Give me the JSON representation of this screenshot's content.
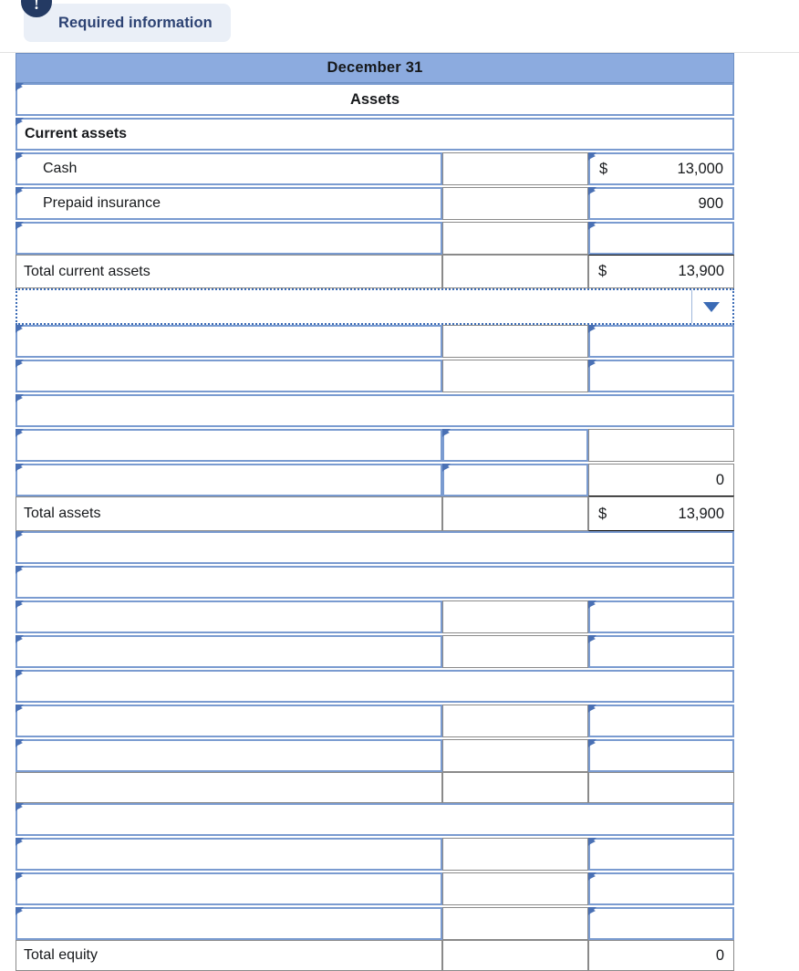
{
  "banner": {
    "icon": "exclamation-badge-icon",
    "label": "Required information"
  },
  "sheet": {
    "header": {
      "date": "December 31"
    },
    "section_title": "Assets",
    "dropdown": {
      "value": "",
      "caret": "chevron-down-icon"
    },
    "colors": {
      "header_bg": "#8cabdf",
      "input_border": "#7a9bd0",
      "marker": "#4a71b5",
      "banner_bg": "#eaeff7",
      "banner_text": "#2c4273",
      "badge_bg": "#243a63"
    },
    "rows": [
      {
        "kind": "header",
        "label": "December 31"
      },
      {
        "kind": "title",
        "label": "Assets"
      },
      {
        "kind": "subhead",
        "label": "Current assets"
      },
      {
        "kind": "line",
        "label": "Cash",
        "col2": "",
        "currency": "$",
        "amount": "13,000"
      },
      {
        "kind": "line",
        "label": "Prepaid insurance",
        "col2": "",
        "currency": "",
        "amount": "900"
      },
      {
        "kind": "line",
        "label": "",
        "col2": "",
        "currency": "",
        "amount": ""
      },
      {
        "kind": "total",
        "label": "Total current assets",
        "col2": "",
        "currency": "$",
        "amount": "13,900"
      },
      {
        "kind": "select",
        "label": ""
      },
      {
        "kind": "line",
        "label": "",
        "col2": "",
        "currency": "",
        "amount": ""
      },
      {
        "kind": "line",
        "label": "",
        "col2": "",
        "currency": "",
        "amount": ""
      },
      {
        "kind": "wide",
        "label": ""
      },
      {
        "kind": "line2",
        "label": "",
        "col2": "",
        "currency": "",
        "amount": ""
      },
      {
        "kind": "line2",
        "label": "",
        "col2": "",
        "currency": "",
        "amount": "0"
      },
      {
        "kind": "total",
        "label": "Total assets",
        "col2": "",
        "currency": "$",
        "amount": "13,900"
      },
      {
        "kind": "wide",
        "label": ""
      },
      {
        "kind": "wide",
        "label": ""
      },
      {
        "kind": "line",
        "label": "",
        "col2": "",
        "currency": "",
        "amount": ""
      },
      {
        "kind": "line",
        "label": "",
        "col2": "",
        "currency": "",
        "amount": ""
      },
      {
        "kind": "wide",
        "label": ""
      },
      {
        "kind": "line",
        "label": "",
        "col2": "",
        "currency": "",
        "amount": ""
      },
      {
        "kind": "line",
        "label": "",
        "col2": "",
        "currency": "",
        "amount": ""
      },
      {
        "kind": "blankrow",
        "label": "",
        "col2": "",
        "currency": "",
        "amount": ""
      },
      {
        "kind": "wide",
        "label": ""
      },
      {
        "kind": "line",
        "label": "",
        "col2": "",
        "currency": "",
        "amount": ""
      },
      {
        "kind": "line",
        "label": "",
        "col2": "",
        "currency": "",
        "amount": ""
      },
      {
        "kind": "line",
        "label": "",
        "col2": "",
        "currency": "",
        "amount": ""
      },
      {
        "kind": "cutoff",
        "label": "Total equity",
        "col2": "",
        "currency": "",
        "amount": "0"
      }
    ]
  }
}
